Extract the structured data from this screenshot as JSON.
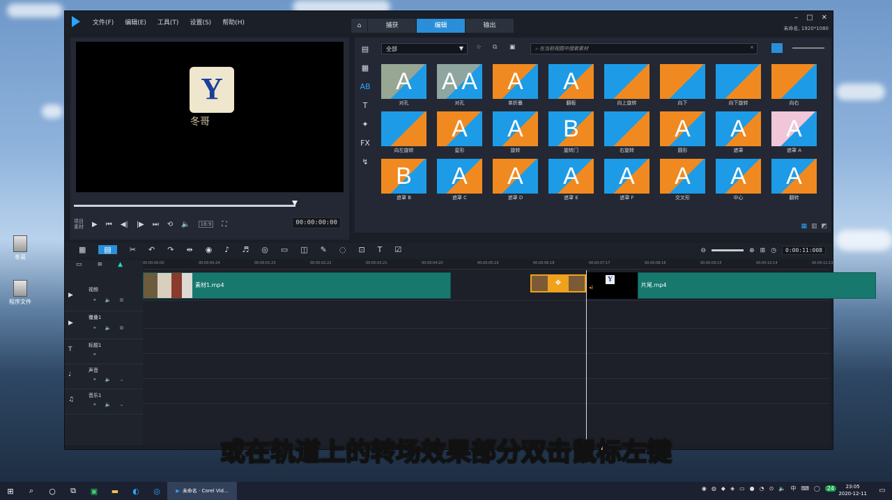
{
  "app": {
    "menus": [
      "文件(F)",
      "编辑(E)",
      "工具(T)",
      "设置(S)",
      "帮助(H)"
    ],
    "mode_tabs": [
      "捕获",
      "编辑",
      "输出"
    ],
    "active_tab": "编辑",
    "project_info": "未命名, 1920*1080"
  },
  "player": {
    "preview_caption": "冬哥",
    "mode_labels": [
      "项目",
      "素材"
    ],
    "aspect": "16:9",
    "timecode": "00:00:00:00"
  },
  "library": {
    "category": "全部",
    "search_placeholder": "在当前视图中搜索素材",
    "transitions": [
      {
        "label": "对孔",
        "icon": "A",
        "bg": "#98a694"
      },
      {
        "label": "对孔",
        "icon": "A A",
        "bg": "#8fa6a0"
      },
      {
        "label": "单折叠",
        "icon": "A",
        "bg": "#f08a20"
      },
      {
        "label": "翻板",
        "icon": "A",
        "bg": "#1e9be6"
      },
      {
        "label": "向上旋转",
        "icon": "",
        "bg": "#1e9be6"
      },
      {
        "label": "向下",
        "icon": "",
        "bg": "#f08a20"
      },
      {
        "label": "向下旋转",
        "icon": "",
        "bg": "#1e9be6"
      },
      {
        "label": "向右",
        "icon": "",
        "bg": "#f08a20"
      },
      {
        "label": "向左旋转",
        "icon": "",
        "bg": "#1e9be6"
      },
      {
        "label": "星形",
        "icon": "A",
        "bg": "#f08a20"
      },
      {
        "label": "旋转",
        "icon": "A",
        "bg": "#1e9be6"
      },
      {
        "label": "旋转门",
        "icon": "B",
        "bg": "#1e9be6"
      },
      {
        "label": "右旋转",
        "icon": "",
        "bg": "#1e9be6"
      },
      {
        "label": "圆形",
        "icon": "A",
        "bg": "#f08a20"
      },
      {
        "label": "遮罩",
        "icon": "A",
        "bg": "#1e9be6"
      },
      {
        "label": "遮罩 A",
        "icon": "A",
        "bg": "#f0c6d8"
      },
      {
        "label": "遮罩 B",
        "icon": "B",
        "bg": "#f08a20"
      },
      {
        "label": "遮罩 C",
        "icon": "A",
        "bg": "#1e9be6"
      },
      {
        "label": "遮罩 D",
        "icon": "A",
        "bg": "#f08a20"
      },
      {
        "label": "遮罩 E",
        "icon": "A",
        "bg": "#1e9be6"
      },
      {
        "label": "遮罩 F",
        "icon": "A",
        "bg": "#1e9be6"
      },
      {
        "label": "交叉形",
        "icon": "A",
        "bg": "#f08a20"
      },
      {
        "label": "中心",
        "icon": "A",
        "bg": "#1e9be6"
      },
      {
        "label": "翻转",
        "icon": "A",
        "bg": "#1e9be6"
      }
    ]
  },
  "timeline": {
    "zoom_time": "0:00:11:008",
    "ruler_ticks": [
      "00:00:00:00",
      "00:00:00:24",
      "00:00:01:23",
      "00:00:02:22",
      "00:00:03:21",
      "00:00:04:20",
      "00:00:05:19",
      "00:00:06:18",
      "00:00:07:17",
      "00:00:08:16",
      "00:00:09:15",
      "00:00:10:14",
      "00:00:11:13"
    ],
    "tracks": [
      {
        "name": "视频"
      },
      {
        "name": "覆叠1"
      },
      {
        "name": "标题1"
      },
      {
        "name": "声音"
      },
      {
        "name": "音乐1"
      }
    ],
    "clip1": "素材1.mp4",
    "clip2": "片尾.mp4"
  },
  "subtitle": "或在轨道上的转场效果部分双击鼠标左键",
  "desktop_icons": [
    "冬哥",
    "程序文件"
  ],
  "taskbar": {
    "task_label": "未命名 · Corel Vid...",
    "time": "23:05",
    "date": "2020-12-11",
    "ime": "中",
    "badge": "24"
  }
}
